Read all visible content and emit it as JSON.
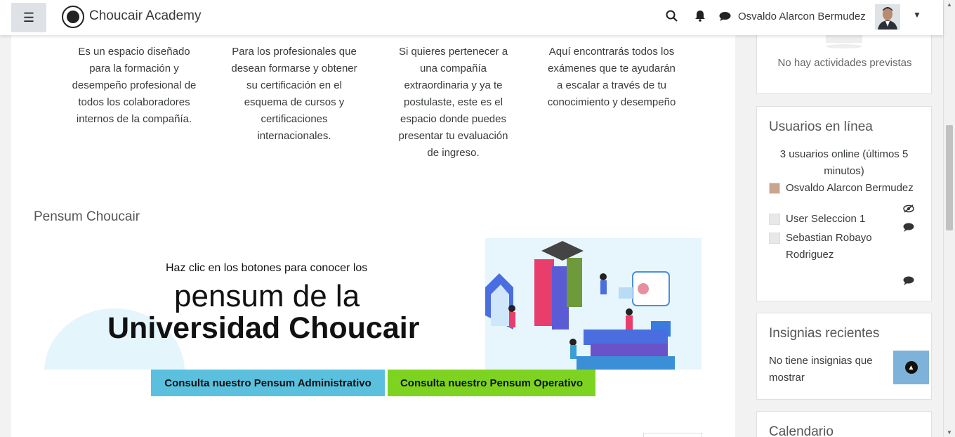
{
  "header": {
    "brand": "Choucair Academy",
    "username": "Osvaldo Alarcon Bermudez",
    "icons": [
      "menu-icon",
      "search-icon",
      "bell-icon",
      "chat-icon",
      "caret-down-icon"
    ]
  },
  "features": [
    {
      "text": "Es un espacio diseñado para la formación y desempeño profesional de todos los colaboradores internos de la compañía."
    },
    {
      "text": "Para los profesionales que desean formarse y obtener su certificación en el esquema de cursos y certificaciones internacionales."
    },
    {
      "text": "Si quieres pertenecer a una compañía extraordinaria y ya te postulaste, este es el espacio donde puedes presentar tu evaluación de ingreso."
    },
    {
      "text": "Aquí encontrarás todos los exámenes que te ayudarán a escalar a través de tu conocimiento y desempeño"
    }
  ],
  "pensum": {
    "title": "Pensum Choucair",
    "banner_line1": "Haz clic en los botones para conocer los",
    "banner_line2": "pensum de la",
    "banner_line3": "Universidad Choucair",
    "btn_admin": "Consulta nuestro Pensum Administrativo",
    "btn_oper": "Consulta nuestro Pensum Operativo",
    "colors": {
      "admin": "#5bc0de",
      "oper": "#7ed321"
    }
  },
  "sidebar": {
    "upcoming_empty": "No hay actividades previstas",
    "online": {
      "title": "Usuarios en línea",
      "summary": "3 usuarios online (últimos 5 minutos)",
      "users": [
        {
          "name": "Osvaldo Alarcon Bermudez"
        },
        {
          "name": "User Seleccion 1"
        },
        {
          "name": "Sebastian Robayo Rodriguez"
        }
      ]
    },
    "badges": {
      "title": "Insignias recientes",
      "empty": "No tiene insignias que mostrar"
    },
    "calendar": {
      "title": "Calendario"
    }
  }
}
